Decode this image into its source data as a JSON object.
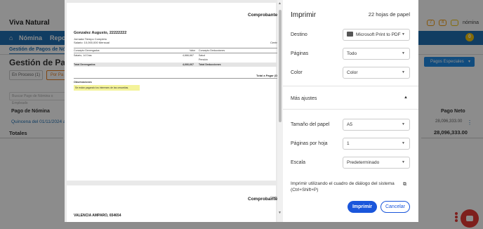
{
  "app": {
    "brand": "Viva Natural",
    "top_right_label": "nómina",
    "badge_1": "7",
    "badge_2": "4",
    "nav": {
      "item1": "Nómina",
      "item2": "Repo",
      "notif_count": "0"
    },
    "breadcrumb": "Gestión de Pagos de Nómina",
    "page_title": "Gestión de Pagos",
    "tabs": [
      "En Proceso (1)",
      "Por Pa"
    ],
    "search_placeholder": "Buscar Pago de Nómina o Empleado",
    "table": {
      "col_left": "Pago de Nómina",
      "row_left": "Quincena del 01/11/2024 al",
      "totals_label": "Totales",
      "col_right": "Pago Neto",
      "row_right": "28,096,333.00",
      "totals_right": "28,096,333.00"
    },
    "special_payments": "Pagos Especiales"
  },
  "preview": {
    "page1": {
      "title": "Comprobante d",
      "employee": "Gonzalez Augusto, 22222222",
      "lines": [
        "Jornada Tiempo Completo",
        "Salario: 10,000,000 Mensual"
      ],
      "right_label": "Centro",
      "headers": [
        "Concepto Devengados",
        "Valor",
        "Concepto Deducciones"
      ],
      "row1": [
        "Salario, 14 Días",
        "4,666,667",
        "Salud"
      ],
      "row2": [
        "Pensión"
      ],
      "totals": [
        "Total Devengados",
        "4,666,667",
        "Total Deducciones"
      ],
      "total_pay": "Total a Pagar (D",
      "observations_title": "Observaciones",
      "observations_text": "Se están pagando los intereses de las cesantías."
    },
    "page2": {
      "title": "Comprobante d",
      "employee": "VALENCIA AMPARO, 654654",
      "right_label": "Centro"
    }
  },
  "print": {
    "title": "Imprimir",
    "sheets": "22 hojas de papel",
    "destination": {
      "label": "Destino",
      "value": "Microsoft Print to PDF"
    },
    "pages": {
      "label": "Páginas",
      "value": "Todo"
    },
    "color": {
      "label": "Color",
      "value": "Color"
    },
    "more_settings": "Más ajustes",
    "paper_size": {
      "label": "Tamaño del papel",
      "value": "A5"
    },
    "pages_per_sheet": {
      "label": "Páginas por hoja",
      "value": "1"
    },
    "scale": {
      "label": "Escala",
      "value": "Predeterminado"
    },
    "system_dialog": "Imprimir utilizando el cuadro de diálogo del sistema (Ctrl+Shift+P)",
    "print_button": "Imprimir",
    "cancel_button": "Cancelar"
  },
  "colors": {
    "primary": "#1f6fb2",
    "accent": "#1a56db",
    "highlight": "#f4f39a",
    "chat": "#e53935"
  }
}
